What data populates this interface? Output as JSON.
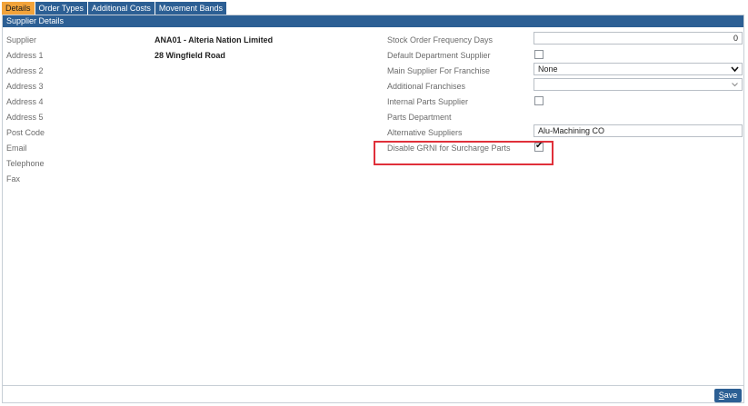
{
  "tabs": [
    {
      "label": "Details",
      "active": true
    },
    {
      "label": "Order Types",
      "active": false
    },
    {
      "label": "Additional Costs",
      "active": false
    },
    {
      "label": "Movement Bands",
      "active": false
    }
  ],
  "panel": {
    "header": "Supplier Details"
  },
  "left_fields": [
    {
      "label": "Supplier",
      "value": "ANA01 - Alteria Nation Limited"
    },
    {
      "label": "Address 1",
      "value": "28 Wingfield Road"
    },
    {
      "label": "Address 2",
      "value": ""
    },
    {
      "label": "Address 3",
      "value": ""
    },
    {
      "label": "Address 4",
      "value": ""
    },
    {
      "label": "Address 5",
      "value": ""
    },
    {
      "label": "Post Code",
      "value": ""
    },
    {
      "label": "Email",
      "value": ""
    },
    {
      "label": "Telephone",
      "value": ""
    },
    {
      "label": "Fax",
      "value": ""
    }
  ],
  "right_fields": {
    "stock_order_frequency_days": {
      "label": "Stock Order Frequency Days",
      "value": "0"
    },
    "default_department_supplier": {
      "label": "Default Department Supplier",
      "checked": false
    },
    "main_supplier_for_franchise": {
      "label": "Main Supplier For Franchise",
      "value": "None"
    },
    "additional_franchises": {
      "label": "Additional Franchises",
      "value": ""
    },
    "internal_parts_supplier": {
      "label": "Internal Parts Supplier",
      "checked": false
    },
    "parts_department": {
      "label": "Parts Department"
    },
    "alternative_suppliers": {
      "label": "Alternative Suppliers",
      "value": "Alu-Machining CO"
    },
    "disable_grni": {
      "label": "Disable GRNI for Surcharge Parts",
      "checked": true
    }
  },
  "footer": {
    "save_first": "S",
    "save_rest": "ave"
  },
  "colors": {
    "accent": "#2c5f94",
    "active_tab": "#f2a33a",
    "highlight": "#e0303a"
  }
}
